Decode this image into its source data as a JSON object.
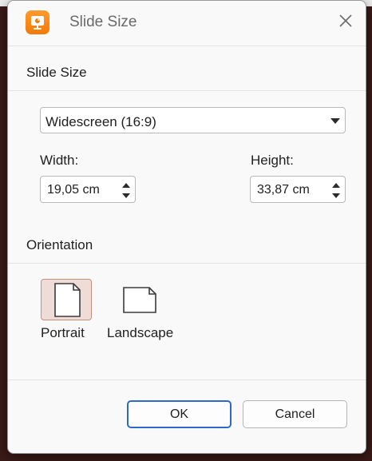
{
  "dialog": {
    "title": "Slide Size",
    "app_icon": "presentation-app-icon",
    "close_icon": "close-icon"
  },
  "slide_size": {
    "section_label": "Slide Size",
    "preset": {
      "selected": "Widescreen (16:9)"
    },
    "width": {
      "label": "Width:",
      "value": "19,05 cm"
    },
    "height": {
      "label": "Height:",
      "value": "33,87 cm"
    }
  },
  "orientation": {
    "section_label": "Orientation",
    "options": [
      {
        "label": "Portrait",
        "icon": "portrait-page-icon",
        "selected": true
      },
      {
        "label": "Landscape",
        "icon": "landscape-page-icon",
        "selected": false
      }
    ]
  },
  "buttons": {
    "ok": "OK",
    "cancel": "Cancel"
  },
  "colors": {
    "accent": "#2c69c9",
    "app_orange": "#f37a06",
    "selected_bg": "#f0dcd6"
  }
}
